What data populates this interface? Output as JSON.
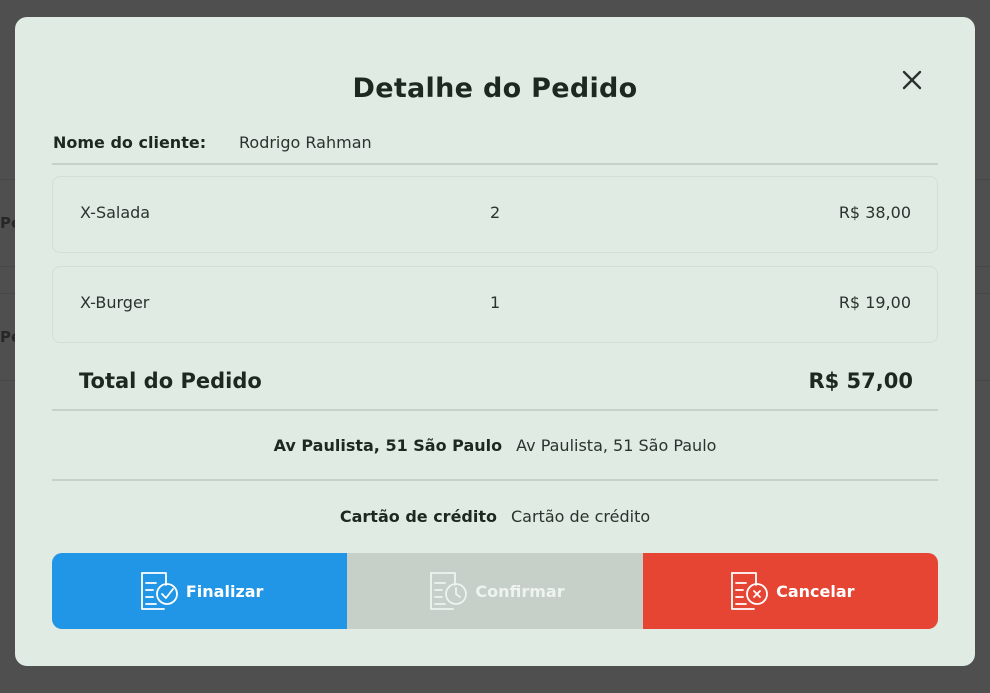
{
  "background": {
    "row_label_1": "Pe",
    "row_label_2": "Pe"
  },
  "modal": {
    "title": "Detalhe do Pedido",
    "close_icon": "close-icon",
    "customer": {
      "label": "Nome do cliente:",
      "value": "Rodrigo Rahman"
    },
    "items": [
      {
        "name": "X-Salada",
        "qty": "2",
        "price": "R$ 38,00"
      },
      {
        "name": "X-Burger",
        "qty": "1",
        "price": "R$ 19,00"
      }
    ],
    "total": {
      "label": "Total do Pedido",
      "value": "R$ 57,00"
    },
    "address": {
      "label": "Av Paulista, 51 São Paulo",
      "value": "Av Paulista, 51 São Paulo"
    },
    "payment": {
      "label": "Cartão de crédito",
      "value": "Cartão de crédito"
    },
    "actions": {
      "finalizar": {
        "label": "Finalizar",
        "icon": "order-check-icon",
        "color": "#2196e6"
      },
      "confirmar": {
        "label": "Confirmar",
        "icon": "order-clock-icon",
        "color": "#c6d0c9"
      },
      "cancelar": {
        "label": "Cancelar",
        "icon": "order-cancel-icon",
        "color": "#e64533"
      }
    }
  }
}
